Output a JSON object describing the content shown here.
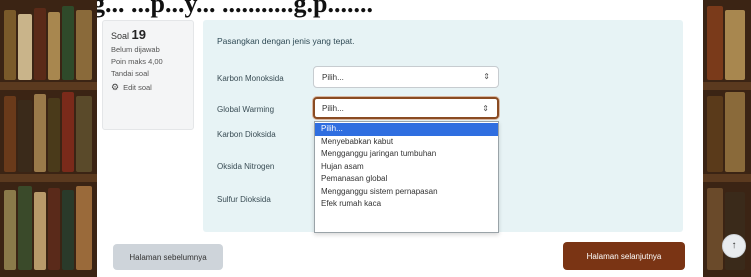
{
  "header": {
    "heading": "g... ...p...y... ...........g.p......."
  },
  "question_info": {
    "label": "Soal",
    "number": "19",
    "status": "Belum dijawab",
    "marks": "Poin maks 4,00",
    "flag_label": "Tandai soal",
    "edit_label": "Edit soal"
  },
  "question": {
    "prompt": "Pasangkan dengan jenis yang tepat.",
    "rows": [
      {
        "label": "Karbon Monoksida",
        "value": "Pilih..."
      },
      {
        "label": "Global Warming",
        "value": "Pilih..."
      },
      {
        "label": "Karbon Dioksida",
        "value": ""
      },
      {
        "label": "Oksida Nitrogen",
        "value": ""
      },
      {
        "label": "Sulfur Dioksida",
        "value": ""
      }
    ],
    "caret": "⇕"
  },
  "dropdown": {
    "options": [
      "Pilih...",
      "Menyebabkan kabut",
      "Mengganggu jaringan tumbuhan",
      "Hujan asam",
      "Pemanasan global",
      "Mengganggu sistem pernapasan",
      "Efek rumah kaca"
    ],
    "active_index": 0
  },
  "nav": {
    "prev_label": "Halaman sebelumnya",
    "next_label": "Halaman selanjutnya"
  },
  "scroll_top_icon": "↑",
  "colors": {
    "accent": "#7a3414",
    "content_bg": "#e7f3f5",
    "dropdown_active": "#2f6ee0"
  }
}
